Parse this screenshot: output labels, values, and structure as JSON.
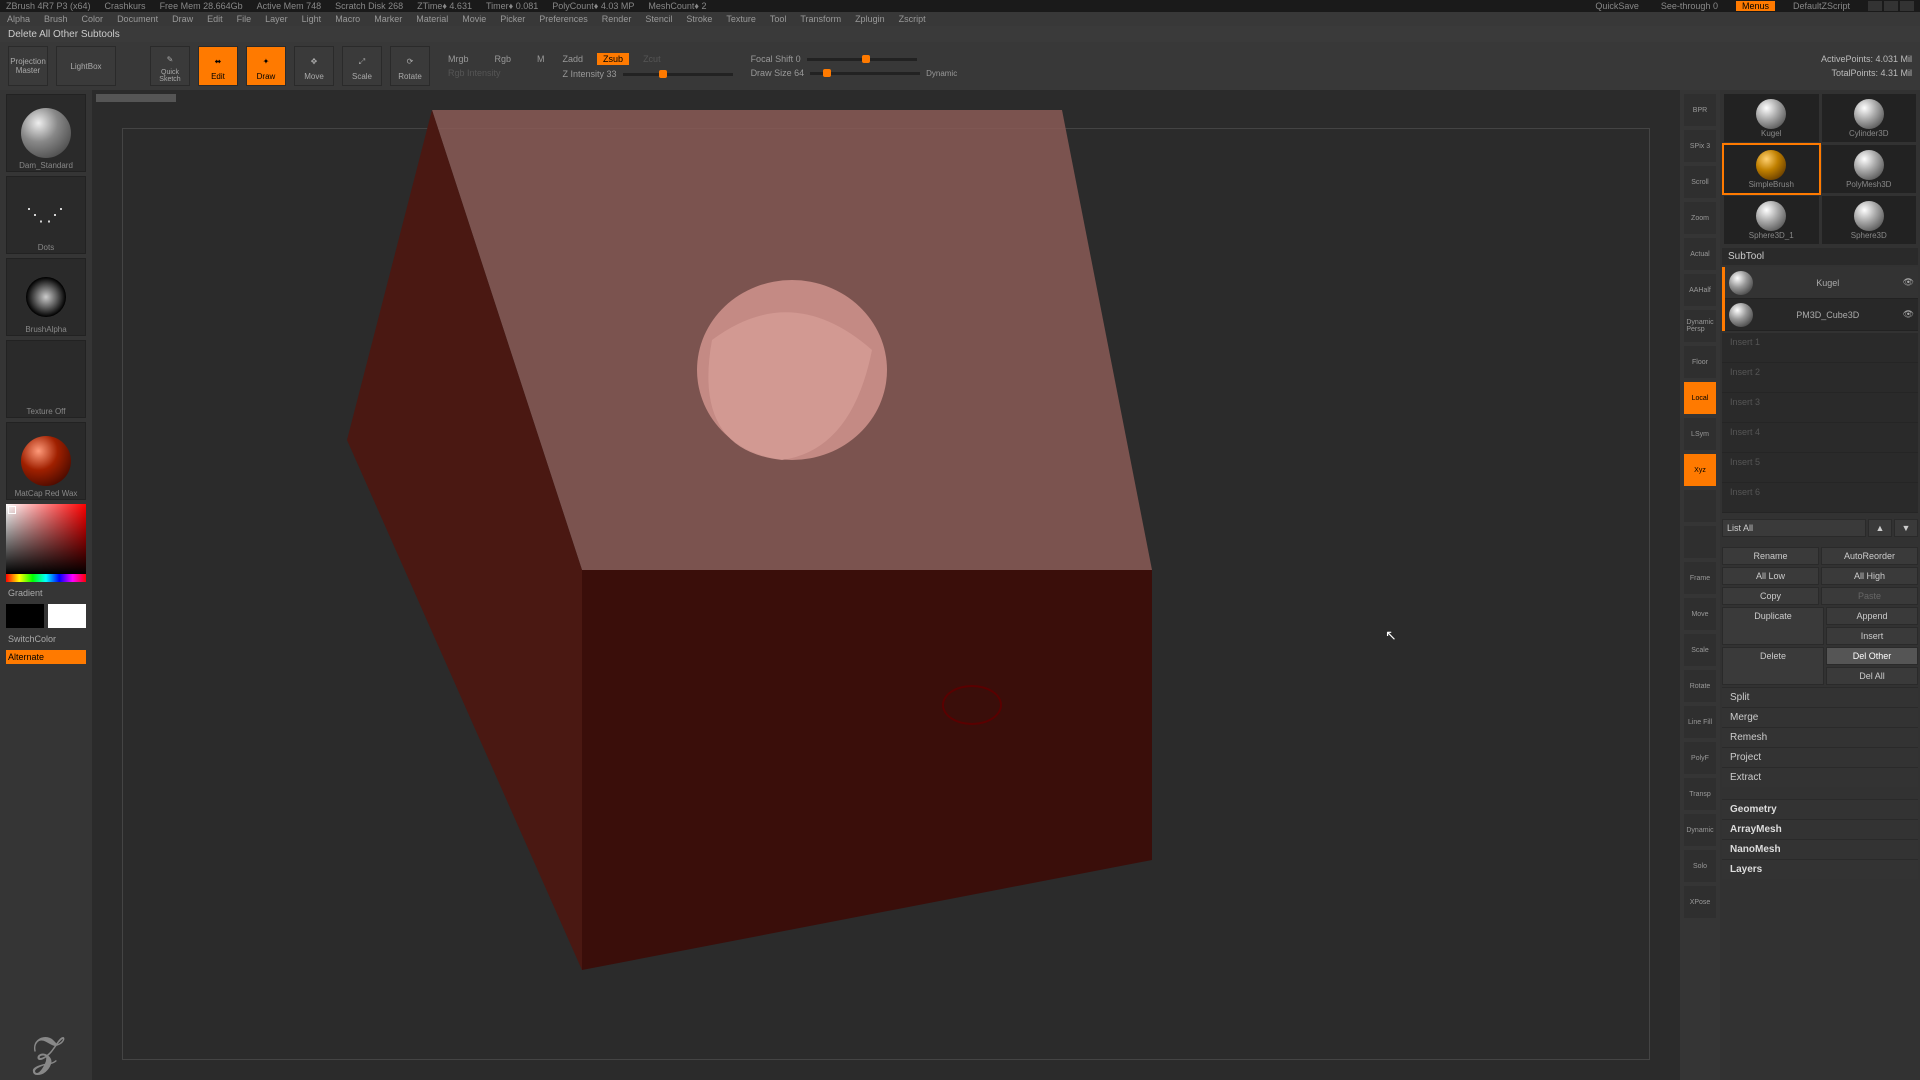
{
  "title": {
    "app": "ZBrush 4R7 P3 (x64)",
    "project": "Crashkurs",
    "freemem": "Free Mem 28.664Gb",
    "activemem": "Active Mem 748",
    "scratch": "Scratch Disk 268",
    "ztime": "ZTime♦ 4.631",
    "timer": "Timer♦ 0.081",
    "polycount": "PolyCount♦ 4.03 MP",
    "meshcount": "MeshCount♦ 2",
    "quicksave": "QuickSave",
    "seethrough": "See-through  0",
    "menus": "Menus",
    "script": "DefaultZScript"
  },
  "menubar": [
    "Alpha",
    "Brush",
    "Color",
    "Document",
    "Draw",
    "Edit",
    "File",
    "Layer",
    "Light",
    "Macro",
    "Marker",
    "Material",
    "Movie",
    "Picker",
    "Preferences",
    "Render",
    "Stencil",
    "Stroke",
    "Texture",
    "Tool",
    "Transform",
    "Zplugin",
    "Zscript"
  ],
  "status": "Delete All Other Subtools",
  "shelf": {
    "projection": "Projection\nMaster",
    "lightbox": "LightBox",
    "quicksketch": "Quick\nSketch",
    "edit": "Edit",
    "draw": "Draw",
    "move": "Move",
    "scale": "Scale",
    "rotate": "Rotate",
    "mrgb": "Mrgb",
    "rgb": "Rgb",
    "m": "M",
    "zadd": "Zadd",
    "zsub": "Zsub",
    "zcut": "Zcut",
    "focal": "Focal Shift 0",
    "zint": "Z Intensity 33",
    "rgbint": "Rgb Intensity",
    "drawsize": "Draw Size 64",
    "dynamic": "Dynamic",
    "active": "ActivePoints: 4.031 Mil",
    "total": "TotalPoints: 4.31 Mil"
  },
  "left": {
    "brush": "Dam_Standard",
    "stroke": "Dots",
    "alpha": "BrushAlpha",
    "texture": "Texture Off",
    "material": "MatCap Red Wax",
    "gradient": "Gradient",
    "switch": "SwitchColor",
    "alternate": "Alternate"
  },
  "rightbtns": [
    "BPR",
    "SPix 3",
    "Scroll",
    "Zoom",
    "Actual",
    "AAHalf",
    "Dynamic\nPersp",
    "Floor",
    "Local",
    "LSym",
    "Xyz",
    "",
    "",
    "Frame",
    "Move",
    "Scale",
    "Rotate",
    "Line Fill",
    "PolyF",
    "Transp",
    "Dynamic",
    "Solo",
    "XPose"
  ],
  "tools": {
    "items": [
      {
        "label": "Kugel"
      },
      {
        "label": "Cylinder3D"
      },
      {
        "label": "SimpleBrush",
        "sel": true
      },
      {
        "label": "PolyMesh3D"
      },
      {
        "label": "Sphere3D_1"
      },
      {
        "label": "Sphere3D"
      },
      {
        "label": "",
        "extra": "Kugel"
      }
    ]
  },
  "subtool": {
    "header": "SubTool",
    "rows": [
      {
        "name": "Kugel",
        "active": true
      },
      {
        "name": "PM3D_Cube3D"
      }
    ],
    "placeholders": [
      "Insert 1",
      "Insert 2",
      "Insert 3",
      "Insert 4",
      "Insert 5",
      "Insert 6"
    ],
    "listall": "List All",
    "rename": "Rename",
    "autoreorder": "AutoReorder",
    "alllow": "All Low",
    "allhigh": "All High",
    "copy": "Copy",
    "paste": "Paste",
    "duplicate": "Duplicate",
    "append": "Append",
    "insert": "Insert",
    "delete": "Delete",
    "delother": "Del Other",
    "delall": "Del All",
    "sections": [
      "Split",
      "Merge",
      "Remesh",
      "Project",
      "Extract"
    ],
    "more": [
      "Geometry",
      "ArrayMesh",
      "NanoMesh",
      "Layers"
    ]
  }
}
